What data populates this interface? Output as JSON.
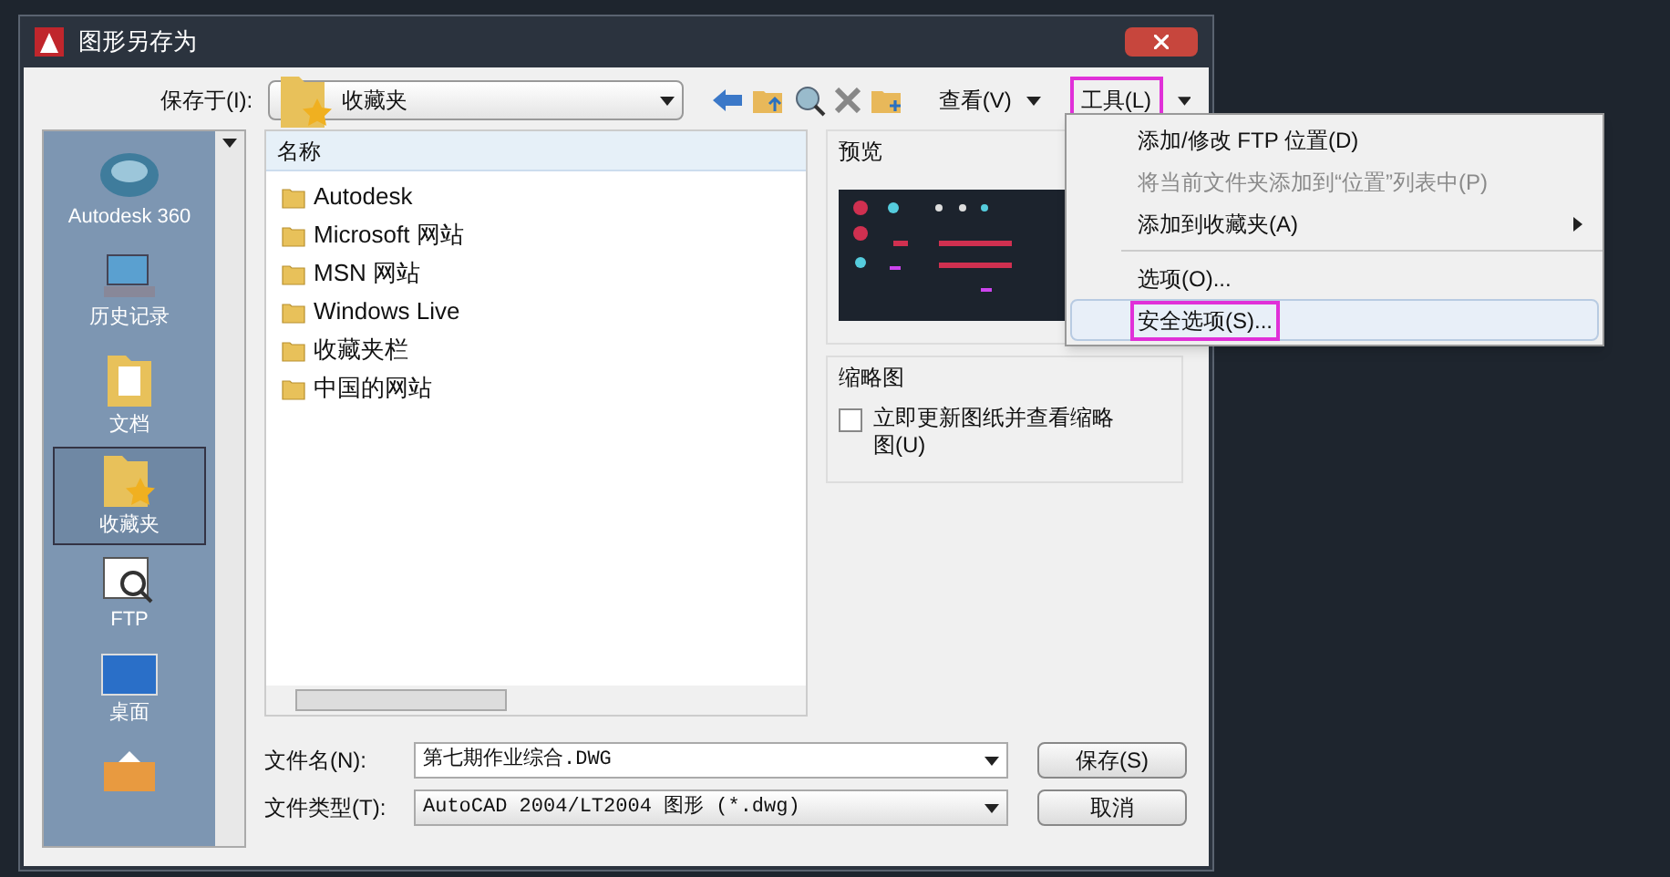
{
  "window": {
    "title": "图形另存为"
  },
  "toolbar": {
    "save_in_label": "保存于(I):",
    "save_in_value": "收藏夹",
    "view_label": "查看(V)",
    "tools_label": "工具(L)",
    "tools_annotated": true
  },
  "places": [
    {
      "label": "Autodesk 360",
      "kind": "cloud",
      "selected": false
    },
    {
      "label": "历史记录",
      "kind": "history",
      "selected": false
    },
    {
      "label": "文档",
      "kind": "documents",
      "selected": false
    },
    {
      "label": "收藏夹",
      "kind": "favorites",
      "selected": true
    },
    {
      "label": "FTP",
      "kind": "ftp",
      "selected": false
    },
    {
      "label": "桌面",
      "kind": "desktop",
      "selected": false
    },
    {
      "kind": "folder",
      "selected": false
    }
  ],
  "file_list": {
    "column": "名称",
    "items": [
      {
        "name": "Autodesk"
      },
      {
        "name": "Microsoft 网站"
      },
      {
        "name": "MSN 网站"
      },
      {
        "name": "Windows Live"
      },
      {
        "name": "收藏夹栏"
      },
      {
        "name": "中国的网站"
      }
    ]
  },
  "preview": {
    "title": "预览"
  },
  "thumbnail": {
    "title": "缩略图",
    "checkbox_label": "立即更新图纸并查看缩略图(U)",
    "checked": false
  },
  "file_name": {
    "label": "文件名(N):",
    "value": "第七期作业综合.DWG"
  },
  "file_type": {
    "label": "文件类型(T):",
    "value": "AutoCAD 2004/LT2004 图形 (*.dwg)"
  },
  "buttons": [
    {
      "label": "保存(S)"
    },
    {
      "label": "取消"
    }
  ],
  "tools_menu": [
    {
      "kind": "item",
      "label": "添加/修改 FTP 位置(D)",
      "disabled": false,
      "submenu": false,
      "highlighted": false,
      "annotated": false
    },
    {
      "kind": "item",
      "label": "将当前文件夹添加到“位置”列表中(P)",
      "disabled": true,
      "submenu": false,
      "highlighted": false,
      "annotated": false
    },
    {
      "kind": "item",
      "label": "添加到收藏夹(A)",
      "disabled": false,
      "submenu": true,
      "highlighted": false,
      "annotated": false
    },
    {
      "kind": "separator"
    },
    {
      "kind": "item",
      "label": "选项(O)...",
      "disabled": false,
      "submenu": false,
      "highlighted": false,
      "annotated": false
    },
    {
      "kind": "item",
      "label": "安全选项(S)...",
      "disabled": false,
      "submenu": false,
      "highlighted": true,
      "annotated": true
    }
  ]
}
